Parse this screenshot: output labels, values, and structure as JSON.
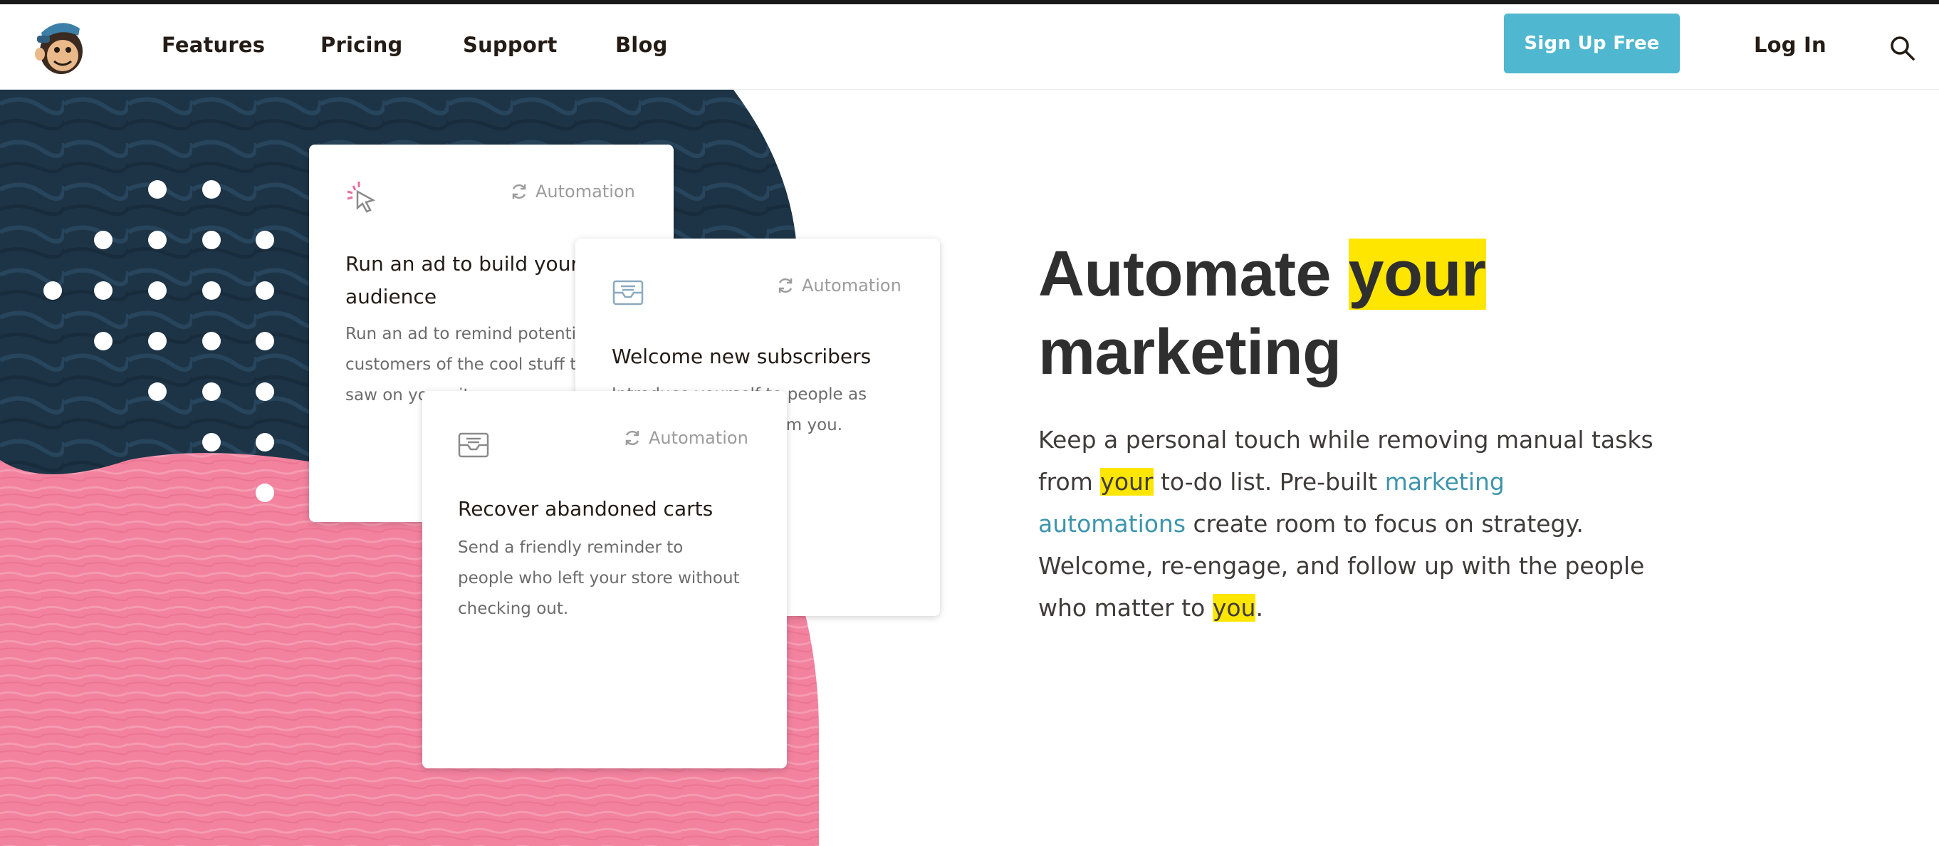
{
  "nav": {
    "links": [
      "Features",
      "Pricing",
      "Support",
      "Blog"
    ],
    "signup_label": "Sign Up Free",
    "login_label": "Log In",
    "logo_icon": "freddie-monkey-logo-icon",
    "search_icon": "magnifier-search-icon"
  },
  "colors": {
    "accent_button": "#4fb7cf",
    "highlight": "#ffe600",
    "link": "#3d95ad",
    "navy_shape": "#1d3447",
    "pink_shape": "#f2829e"
  },
  "cards": [
    {
      "tag": "Automation",
      "title_lines": [
        "Run an ad to build your",
        "audience"
      ],
      "body_lines": [
        "Run an ad to remind potential",
        "customers of the cool stuff they",
        "saw on your site."
      ],
      "icon": "cursor-click-icon"
    },
    {
      "tag": "Automation",
      "title_lines": [
        "Welcome new subscribers"
      ],
      "body_lines": [
        "Introduce yourself to people as",
        "soon as they hear from you."
      ],
      "icon": "envelope-icon"
    },
    {
      "tag": "Automation",
      "title_lines": [
        "Recover abandoned carts"
      ],
      "body_lines": [
        "Send a friendly reminder to",
        "people who left your store without",
        "checking out."
      ],
      "icon": "envelope-icon"
    }
  ],
  "hero": {
    "headline_part1": "Automate ",
    "headline_highlight": "your",
    "headline_line2": "marketing",
    "para_1": "Keep a personal touch while removing manual tasks",
    "para_2_pre": "from ",
    "para_2_hl": "your",
    "para_2_post": " to-do list. Pre-built ",
    "para_2_link": "marketing",
    "para_3_link": "automations",
    "para_3_post": " create room to focus on strategy.",
    "para_4": "Welcome, re-engage, and follow up with the people",
    "para_5_pre": "who matter to ",
    "para_5_hl": "you",
    "para_5_post": "."
  }
}
